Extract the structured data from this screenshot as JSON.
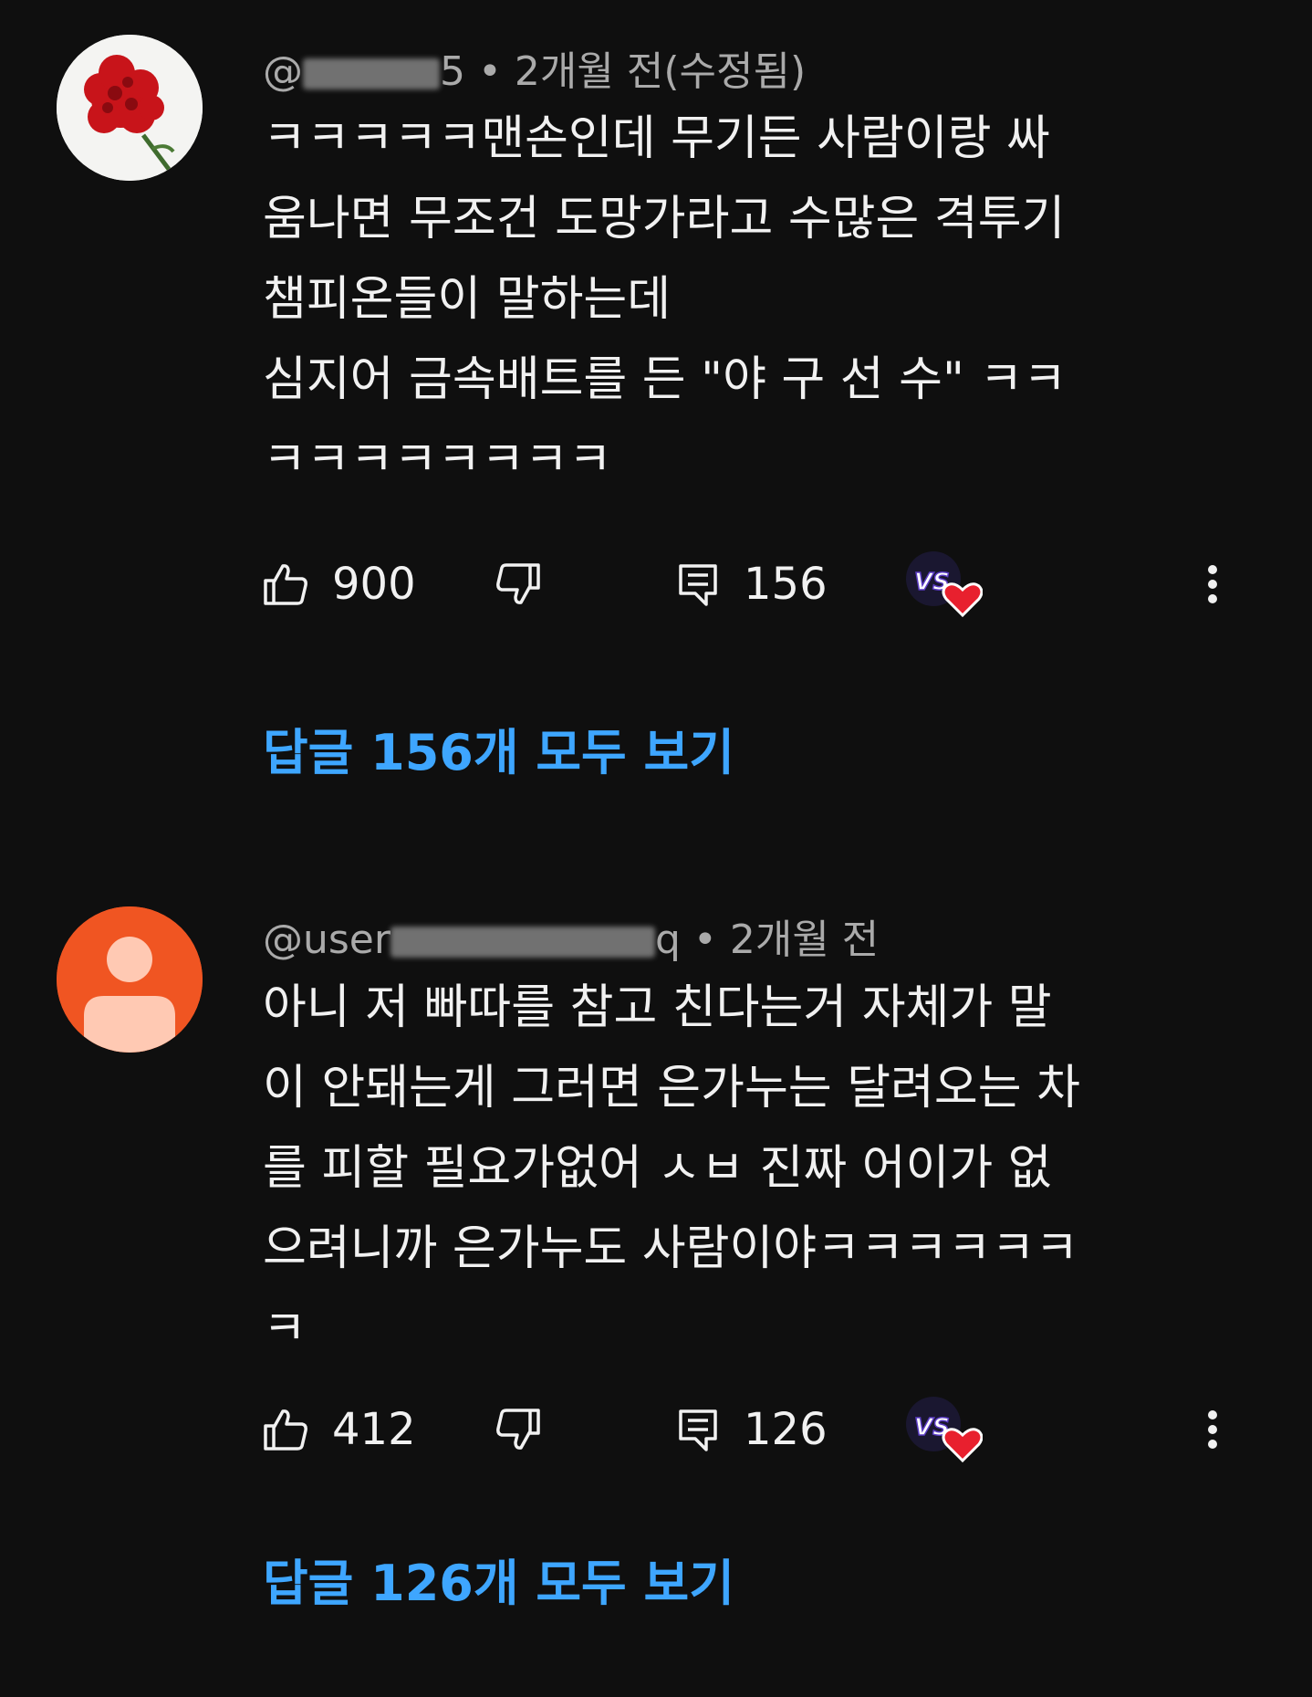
{
  "comments": [
    {
      "handle_prefix": "@",
      "handle_suffix": "5",
      "meta": " • 2개월 전(수정됨)",
      "text": "ㅋㅋㅋㅋㅋ맨손인데 무기든 사람이랑 싸\n움나면 무조건 도망가라고 수많은 격투기\n챔피온들이 말하는데\n심지어 금속배트를 든 \"야 구 선 수\" ㅋㅋ\nㅋㅋㅋㅋㅋㅋㅋㅋ",
      "likes": "900",
      "replies": "156",
      "view_replies": "답글 156개 모두 보기"
    },
    {
      "handle_prefix": "@user",
      "handle_suffix": "q",
      "meta": " • 2개월 전",
      "text": "아니 저 빠따를 참고 친다는거 자체가 말\n이 안돼는게 그러면 은가누는 달려오는 차\n를 피할 필요가없어 ㅅㅂ 진짜 어이가 없\n으려니까 은가누도 사람이야ㅋㅋㅋㅋㅋㅋ\nㅋ",
      "likes": "412",
      "replies": "126",
      "view_replies": "답글 126개 모두 보기"
    }
  ],
  "icons": {
    "like": "thumbs-up-icon",
    "dislike": "thumbs-down-icon",
    "reply": "comment-icon",
    "creator_heart": "creator-heart-badge",
    "more": "more-vertical-icon"
  },
  "colors": {
    "background": "#0f0f0f",
    "text": "#f1f1f1",
    "meta": "#aaaaaa",
    "link": "#3ea6ff",
    "heart": "#e8202e"
  }
}
